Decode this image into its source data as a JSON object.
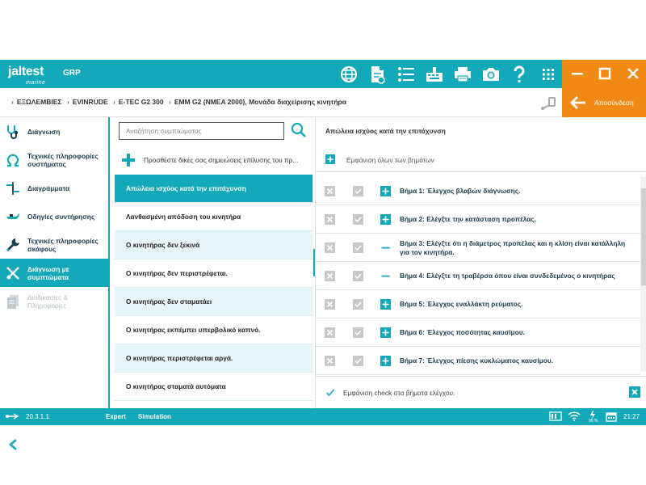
{
  "app": {
    "logo_main": "jaltest",
    "logo_sub": "marine",
    "product": "GRP"
  },
  "toolbar": {
    "icons": [
      "globe-icon",
      "document-icon",
      "list-icon",
      "keyboard-icon",
      "printer-icon",
      "camera-icon",
      "help-icon",
      "grid-icon"
    ]
  },
  "breadcrumb": [
    "ΕΞΩΛΕΜΒΙΕΣ",
    "EVINRUDE",
    "E-TEC G2 300",
    "EMM G2 (NMEA 2000), Μονάδα διαχείρισης κινητήρα"
  ],
  "logout_label": "Αποσύνδεση",
  "sidebar": {
    "items": [
      {
        "label": "Διάγνωση",
        "icon": "stethoscope-icon",
        "state": "normal"
      },
      {
        "label": "Τεχνικές πληροφορίες συστήματος",
        "icon": "ohm-icon",
        "state": "normal"
      },
      {
        "label": "Διαγράμματα",
        "icon": "diagram-icon",
        "state": "normal"
      },
      {
        "label": "Οδηγίες συντήρησης",
        "icon": "oilcan-icon",
        "state": "normal"
      },
      {
        "label": "Τεχνικές πληροφορίες σκάφους",
        "icon": "wrench-icon",
        "state": "normal"
      },
      {
        "label": "Διάγνωση με συμπτώματα",
        "icon": "symptom-tools-icon",
        "state": "active"
      },
      {
        "label": "Διαδικασίες & Πληροφορίες",
        "icon": "documents-icon",
        "state": "disabled"
      }
    ]
  },
  "middle": {
    "search_placeholder": "Αναζήτηση συμπτώματος",
    "add_note_label": "Προσθέστε δικές σας σημειώσεις επίλυσης του πρ...",
    "symptoms": [
      "Απώλεια ισχύος κατά την επιτάχυνση",
      "Λανθασμένη απόδοση του κινητήρα",
      "Ο κινητήρας δεν ξεκινά",
      "Ο κινητήρας δεν περιστρέφεται.",
      "Ο κινητήρας δεν σταματάει",
      "Ο κινητήρας εκπέμπει υπερβολικό καπνό.",
      "Ο κινητήρας περιστρέφεται αργά.",
      "Ο κινητήρας σταματά αυτόματα"
    ],
    "active_index": 0
  },
  "right": {
    "title": "Απώλεια ισχύος κατά την επιτάχυνση",
    "show_all_label": "Εμφάνιση όλων των βημάτων",
    "steps": [
      {
        "text": "Βήμα 1: Έλεγχος βλαβών διάγνωσης.",
        "expanded": false
      },
      {
        "text": "Βήμα 2: Ελέγξτε την κατάσταση προπέλας.",
        "expanded": false
      },
      {
        "text": "Βήμα 3: Ελέγξτε ότι η διάμετρος προπέλας και η κλίση είναι κατάλληλη για τον κινητήρα.",
        "expanded": true
      },
      {
        "text": "Βήμα 4: Ελέγξτε τη τραβέρσα όπου είναι συνδεδεμένος ο κινητήρας",
        "expanded": true
      },
      {
        "text": "Βήμα 5: Έλεγχος εναλλάκτη ρεύματος.",
        "expanded": false
      },
      {
        "text": "Βήμα 6: Έλεγχος ποσότητας καυσίμου.",
        "expanded": false
      },
      {
        "text": "Βήμα 7: Έλεγχος πίεσης κυκλώματος καυσίμου.",
        "expanded": false
      }
    ],
    "footer_check_label": "Εμφάνιση check στα βήματα ελέγχου."
  },
  "status": {
    "version": "20.3.1.1",
    "mode": "Expert",
    "simulation": "Simulation",
    "battery_pct": "99 %",
    "time": "21:27"
  },
  "colors": {
    "accent": "#14a9b8",
    "orange": "#f08a14",
    "disabled": "#c8c8c8"
  }
}
